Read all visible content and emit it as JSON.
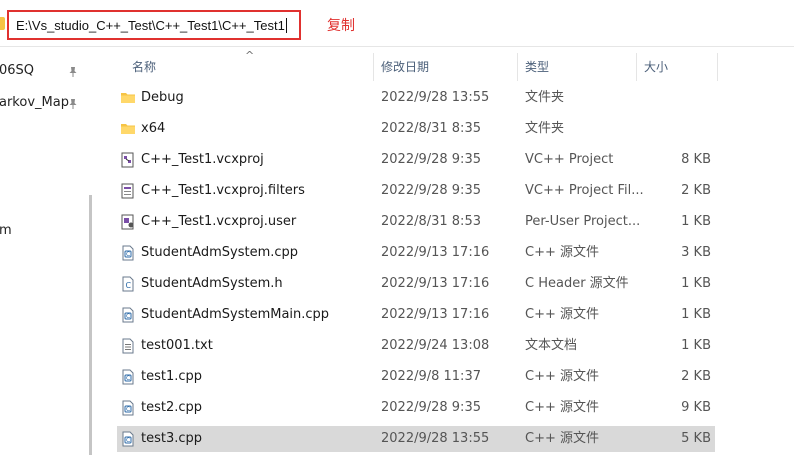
{
  "address_bar": {
    "path": "E:\\Vs_studio_C++_Test\\C++_Test1\\C++_Test1",
    "annotation": "复制"
  },
  "nav_pane": {
    "items": [
      {
        "label": "06SQ",
        "pinned": true
      },
      {
        "label": "arkov_Map",
        "pinned": true
      },
      {
        "label": "m",
        "pinned": false
      }
    ]
  },
  "columns": {
    "name": "名称",
    "date": "修改日期",
    "type": "类型",
    "size": "大小"
  },
  "sort_indicator": "^",
  "files": [
    {
      "name": "Debug",
      "date": "2022/9/28 13:55",
      "type": "文件夹",
      "size": "",
      "icon": "folder-icon",
      "selected": false
    },
    {
      "name": "x64",
      "date": "2022/8/31 8:35",
      "type": "文件夹",
      "size": "",
      "icon": "folder-icon",
      "selected": false
    },
    {
      "name": "C++_Test1.vcxproj",
      "date": "2022/9/28 9:35",
      "type": "VC++ Project",
      "size": "8 KB",
      "icon": "vcxproj-icon",
      "selected": false
    },
    {
      "name": "C++_Test1.vcxproj.filters",
      "date": "2022/9/28 9:35",
      "type": "VC++ Project Fil...",
      "size": "2 KB",
      "icon": "filters-icon",
      "selected": false
    },
    {
      "name": "C++_Test1.vcxproj.user",
      "date": "2022/8/31 8:53",
      "type": "Per-User Project...",
      "size": "1 KB",
      "icon": "user-project-icon",
      "selected": false
    },
    {
      "name": "StudentAdmSystem.cpp",
      "date": "2022/9/13 17:16",
      "type": "C++ 源文件",
      "size": "3 KB",
      "icon": "cpp-file-icon",
      "selected": false
    },
    {
      "name": "StudentAdmSystem.h",
      "date": "2022/9/13 17:16",
      "type": "C Header 源文件",
      "size": "1 KB",
      "icon": "header-file-icon",
      "selected": false
    },
    {
      "name": "StudentAdmSystemMain.cpp",
      "date": "2022/9/13 17:16",
      "type": "C++ 源文件",
      "size": "1 KB",
      "icon": "cpp-file-icon",
      "selected": false
    },
    {
      "name": "test001.txt",
      "date": "2022/9/24 13:08",
      "type": "文本文档",
      "size": "1 KB",
      "icon": "text-file-icon",
      "selected": false
    },
    {
      "name": "test1.cpp",
      "date": "2022/9/8 11:37",
      "type": "C++ 源文件",
      "size": "2 KB",
      "icon": "cpp-file-icon",
      "selected": false
    },
    {
      "name": "test2.cpp",
      "date": "2022/9/28 9:35",
      "type": "C++ 源文件",
      "size": "9 KB",
      "icon": "cpp-file-icon",
      "selected": false
    },
    {
      "name": "test3.cpp",
      "date": "2022/9/28 13:55",
      "type": "C++ 源文件",
      "size": "5 KB",
      "icon": "cpp-file-icon",
      "selected": true
    }
  ],
  "colors": {
    "highlight_red": "#e0312f",
    "folder_yellow": "#f6c445",
    "header_text": "#4c607a",
    "selected_row": "#d9d9d9"
  }
}
